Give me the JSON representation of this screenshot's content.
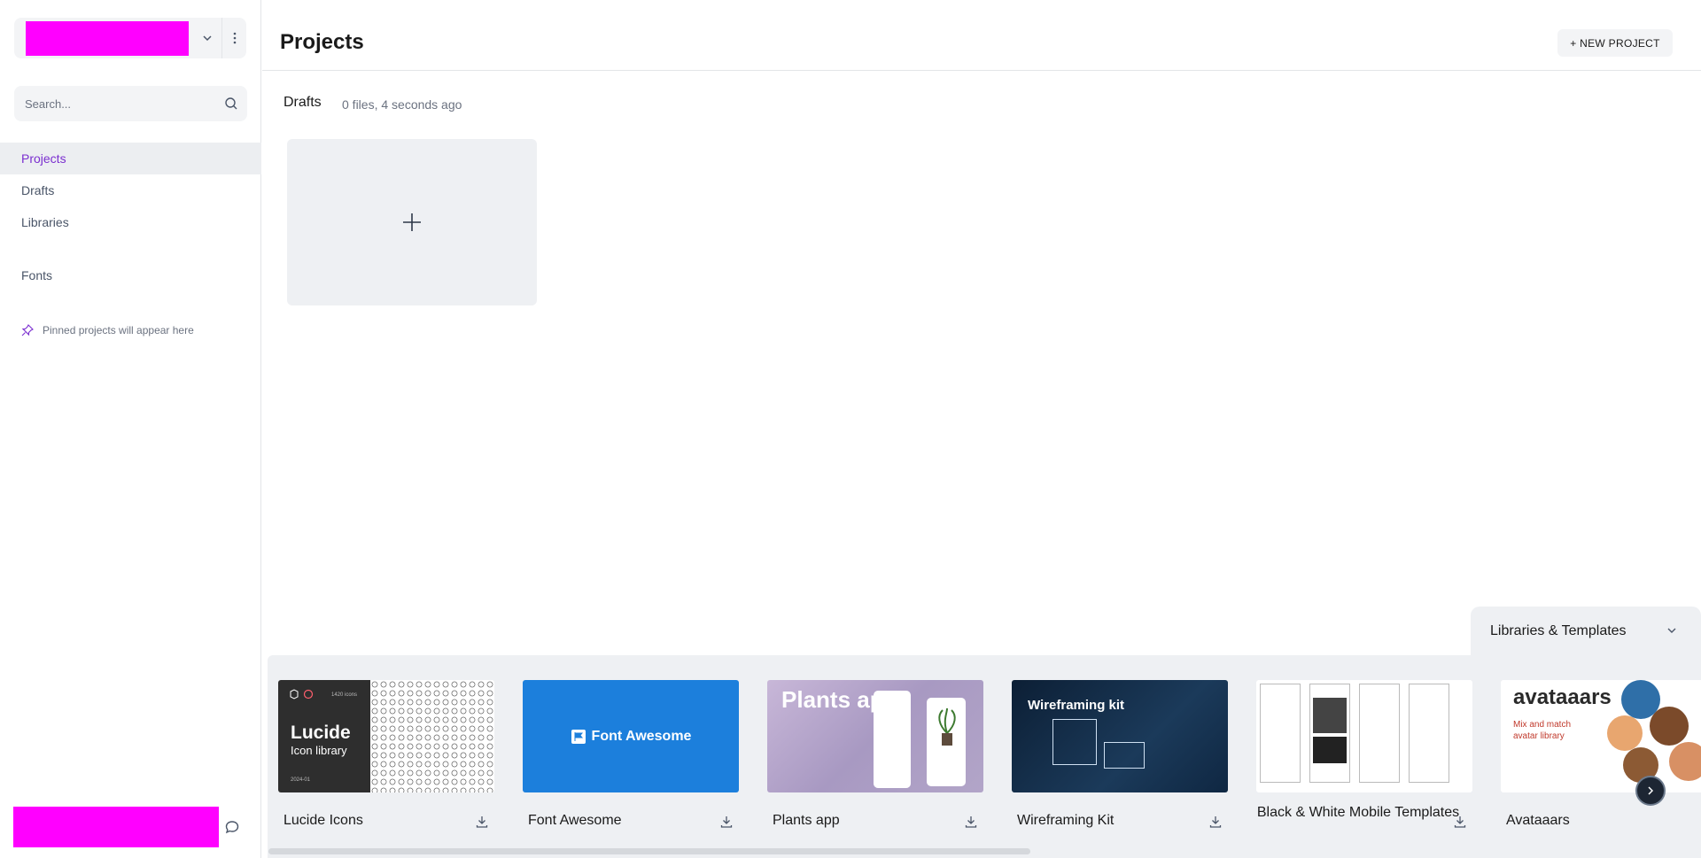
{
  "sidebar": {
    "search_placeholder": "Search...",
    "nav": [
      {
        "label": "Projects",
        "active": true
      },
      {
        "label": "Drafts"
      },
      {
        "label": "Libraries"
      },
      {
        "label": "Fonts"
      }
    ],
    "pinned_hint": "Pinned projects will appear here"
  },
  "header": {
    "title": "Projects",
    "new_project_label": "+ NEW PROJECT"
  },
  "drafts": {
    "title": "Drafts",
    "meta": "0 files, 4 seconds ago"
  },
  "libraries_templates": {
    "tab_label": "Libraries & Templates",
    "items": [
      {
        "name": "Lucide Icons",
        "thumb_text": "Lucide",
        "thumb_sub": "Icon library",
        "thumb_count": "1420 icons",
        "thumb_date": "2024-01"
      },
      {
        "name": "Font Awesome",
        "thumb_text": "Font Awesome"
      },
      {
        "name": "Plants app",
        "thumb_text": "Plants app"
      },
      {
        "name": "Wireframing Kit",
        "thumb_text": "Wireframing kit"
      },
      {
        "name": "Black & White Mobile Templates"
      },
      {
        "name": "Avataaars",
        "thumb_text": "avataaars",
        "thumb_sub": "Mix and match avatar library"
      }
    ]
  },
  "colors": {
    "accent": "#7b2fd0",
    "panel_bg": "#eef0f3",
    "fa_blue": "#1c7fdc"
  }
}
